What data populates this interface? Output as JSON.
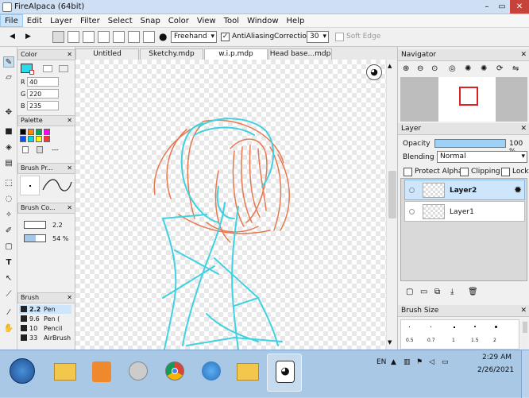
{
  "window": {
    "title": "FireAlpaca (64bit)"
  },
  "menu": [
    "File",
    "Edit",
    "Layer",
    "Filter",
    "Select",
    "Snap",
    "Color",
    "View",
    "Tool",
    "Window",
    "Help"
  ],
  "toolbar": {
    "mode_value": "Freehand",
    "antialiasing_label": "AntiAliasing",
    "correction_label": "Correction",
    "correction_value": "30",
    "soft_edge_label": "Soft Edge"
  },
  "color_panel": {
    "title": "Color",
    "r_label": "R",
    "r": "40",
    "g_label": "G",
    "g": "220",
    "b_label": "B",
    "b": "235",
    "current_color": "#28dceb"
  },
  "palette_panel": {
    "title": "Palette",
    "dash": "---",
    "swatches": [
      "#000000",
      "#ff8800",
      "#00aa55",
      "#ff00ff",
      "#0055ff",
      "#00dddd",
      "#ffff00",
      "#ff3333"
    ]
  },
  "brush_preview_panel": {
    "title": "Brush Pr..."
  },
  "brush_control_panel": {
    "title": "Brush Co...",
    "size": "2.2",
    "opacity": "54 %"
  },
  "brush_panel": {
    "title": "Brush",
    "items": [
      {
        "size": "2.2",
        "name": "Pen",
        "active": true
      },
      {
        "size": "9.6",
        "name": "Pen (",
        "active": false
      },
      {
        "size": "10",
        "name": "Pencil",
        "active": false
      },
      {
        "size": "33",
        "name": "AirBrush",
        "active": false
      }
    ]
  },
  "tabs": [
    {
      "label": "Untitled",
      "active": false
    },
    {
      "label": "Sketchy.mdp",
      "active": false
    },
    {
      "label": "w.i.p.mdp",
      "active": true
    },
    {
      "label": "Head base...mdp",
      "active": false
    }
  ],
  "navigator": {
    "title": "Navigator"
  },
  "layer_panel": {
    "title": "Layer",
    "opacity_label": "Opacity",
    "opacity_value": "100 %",
    "blending_label": "Blending",
    "blending_value": "Normal",
    "protect_alpha_label": "Protect Alpha",
    "clipping_label": "Clipping",
    "lock_label": "Lock",
    "layers": [
      {
        "name": "Layer2",
        "active": true
      },
      {
        "name": "Layer1",
        "active": false
      }
    ]
  },
  "brush_size_panel": {
    "title": "Brush Size",
    "sizes": [
      "0.5",
      "0.7",
      "1",
      "1.5",
      "2"
    ]
  },
  "taskbar": {
    "lang": "EN",
    "time": "2:29 AM",
    "date": "2/26/2021"
  },
  "stroke_colors": {
    "cyan": "#3fd2e0",
    "orange": "#e8784f"
  }
}
